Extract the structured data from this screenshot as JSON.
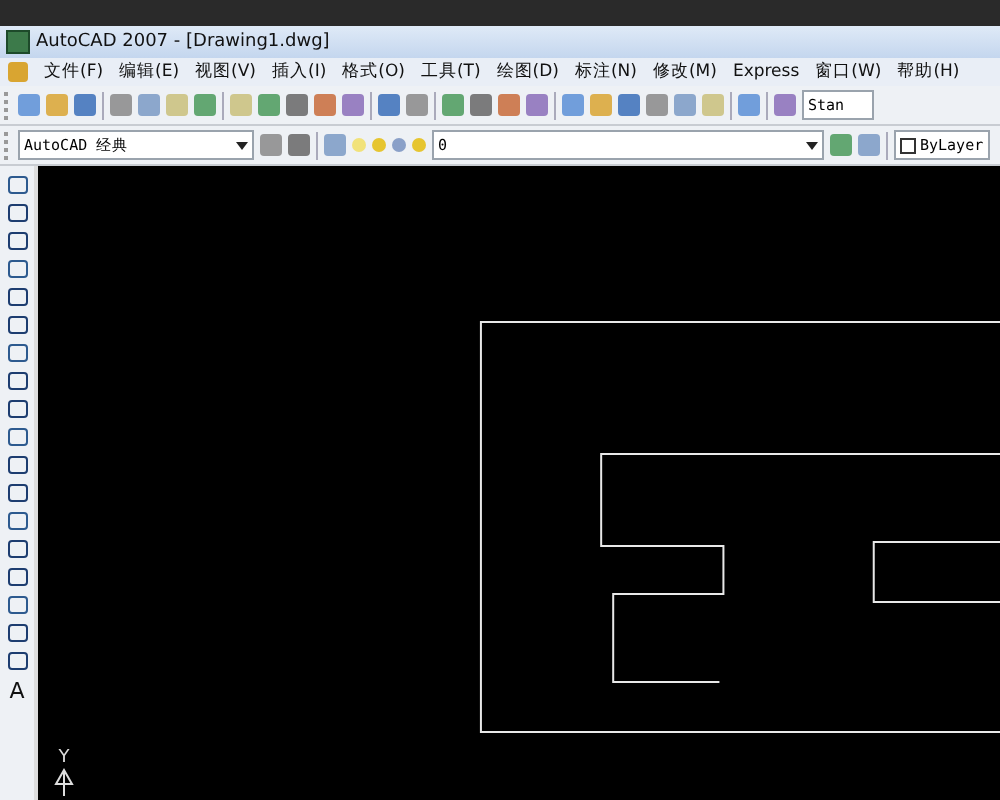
{
  "window": {
    "title": "AutoCAD 2007 - [Drawing1.dwg]"
  },
  "menu": [
    "文件(F)",
    "编辑(E)",
    "视图(V)",
    "插入(I)",
    "格式(O)",
    "工具(T)",
    "绘图(D)",
    "标注(N)",
    "修改(M)",
    "Express",
    "窗口(W)",
    "帮助(H)"
  ],
  "standard_toolbar": {
    "text_style": "Stan"
  },
  "workspace_toolbar": {
    "workspace": "AutoCAD 经典"
  },
  "layers_toolbar": {
    "layer": "0"
  },
  "properties_toolbar": {
    "color_setting": "ByLayer"
  },
  "draw_toolbar": {
    "text_tool": "A"
  },
  "ucs_icon": {
    "axis_label": "Y"
  }
}
